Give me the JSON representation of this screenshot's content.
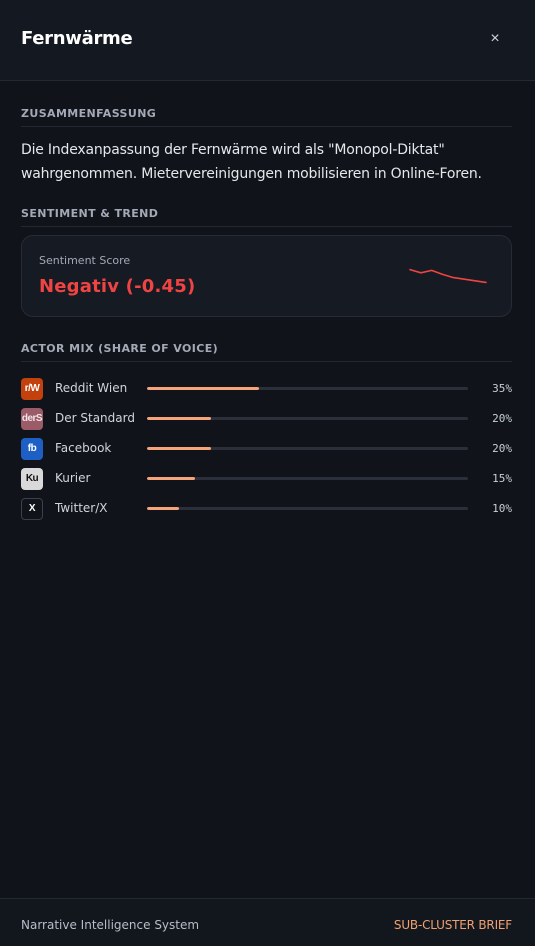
{
  "header": {
    "title": "Fernwärme",
    "close_icon": "close-icon",
    "close_glyph": "×"
  },
  "sections": {
    "summary_label": "ZUSAMMENFASSUNG",
    "summary_text": "Die Indexanpassung der Fernwärme wird als \"Monopol-Diktat\" wahrgenommen. Mietervereinigungen mobilisieren in Online-Foren.",
    "sentiment_label": "SENTIMENT & TREND",
    "actor_label": "ACTOR MIX (SHARE OF VOICE)"
  },
  "sentiment": {
    "label": "Sentiment Score",
    "value": "Negativ (-0.45)",
    "color": "#ef4444",
    "trend": [
      0.62,
      0.66,
      0.63,
      0.68,
      0.72,
      0.74,
      0.76,
      0.78
    ]
  },
  "actors": [
    {
      "icon_text": "r/W",
      "name": "Reddit Wien",
      "share": 35,
      "pct_label": "35%",
      "icon_bg": "#c2410c",
      "icon_fg": "#ffffff"
    },
    {
      "icon_text": "derS",
      "name": "Der Standard",
      "share": 20,
      "pct_label": "20%",
      "icon_bg": "#9b5b68",
      "icon_fg": "#f3e6e8"
    },
    {
      "icon_text": "fb",
      "name": "Facebook",
      "share": 20,
      "pct_label": "20%",
      "icon_bg": "#1d5fc4",
      "icon_fg": "#ffffff"
    },
    {
      "icon_text": "Ku",
      "name": "Kurier",
      "share": 15,
      "pct_label": "15%",
      "icon_bg": "#d9d9d9",
      "icon_fg": "#111111"
    },
    {
      "icon_text": "X",
      "name": "Twitter/X",
      "share": 10,
      "pct_label": "10%",
      "icon_bg": "#10131a",
      "icon_fg": "#ffffff"
    }
  ],
  "footer": {
    "left": "Narrative Intelligence System",
    "right": "SUB-CLUSTER BRIEF"
  },
  "colors": {
    "accent": "#f6a47a",
    "negative": "#ef4444"
  }
}
